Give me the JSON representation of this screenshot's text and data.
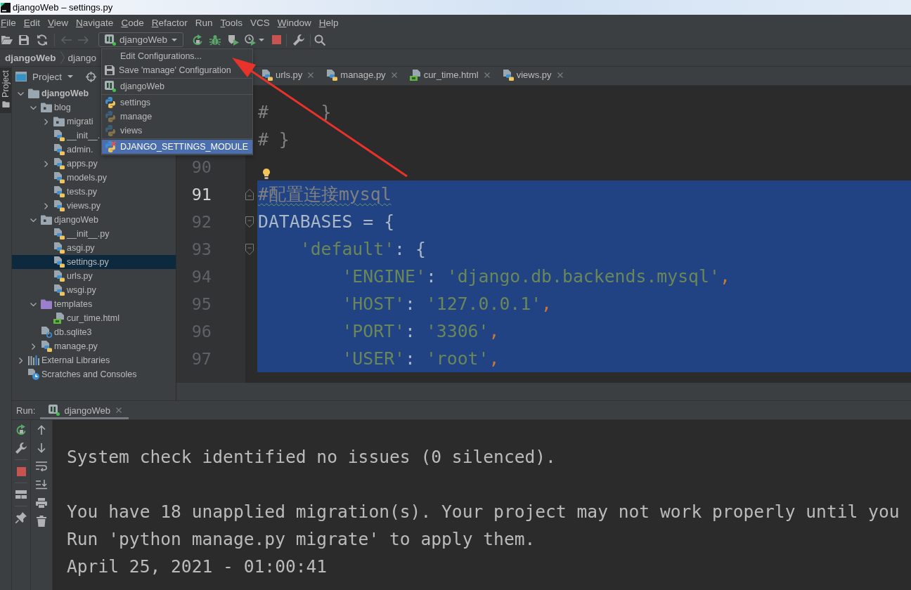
{
  "window": {
    "title": "djangoWeb – settings.py"
  },
  "menu": [
    {
      "label": "File",
      "mnemonic": true
    },
    {
      "label": "Edit",
      "mnemonic": true
    },
    {
      "label": "View",
      "mnemonic": true
    },
    {
      "label": "Navigate",
      "mnemonic": true
    },
    {
      "label": "Code",
      "mnemonic": true
    },
    {
      "label": "Refactor",
      "mnemonic": true
    },
    {
      "label": "Run",
      "mnemonic": false
    },
    {
      "label": "Tools",
      "mnemonic": true
    },
    {
      "label": "VCS",
      "mnemonic": false
    },
    {
      "label": "Window",
      "mnemonic": true
    },
    {
      "label": "Help",
      "mnemonic": true
    }
  ],
  "toolbar": {
    "back": {
      "disabled": true
    },
    "forward": {
      "disabled": true
    },
    "run_config": {
      "label": "djangoWeb",
      "open": true,
      "menu": [
        [
          {
            "label": "Edit Configurations...",
            "kind": "action",
            "selected": false
          },
          {
            "label": "Save 'manage' Configuration",
            "kind": "save",
            "selected": false
          }
        ],
        [
          {
            "label": "djangoWeb",
            "kind": "django",
            "selected": false
          }
        ],
        [
          {
            "label": "settings",
            "kind": "python",
            "selected": false
          },
          {
            "label": "manage",
            "kind": "python-temporary",
            "selected": false
          },
          {
            "label": "views",
            "kind": "python-temporary",
            "selected": false
          }
        ],
        [
          {
            "label": "DJANGO_SETTINGS_MODULE",
            "kind": "python-error",
            "selected": true
          }
        ]
      ]
    },
    "stop": {
      "disabled": false
    }
  },
  "breadcrumbs": [
    {
      "label": "djangoWeb"
    },
    {
      "label": "django"
    }
  ],
  "tool_strip": [
    {
      "label": "Project",
      "selected": true
    }
  ],
  "project": {
    "title": "Project",
    "tree": [
      {
        "label": "djangoWeb",
        "kind": "root",
        "expanded": true,
        "selected": false,
        "children": [
          {
            "label": "blog",
            "kind": "package",
            "expanded": true,
            "selected": false,
            "children": [
              {
                "label": "migrati",
                "kind": "package",
                "expanded": false,
                "selected": false
              },
              {
                "label": "__init__.",
                "kind": "python",
                "selected": false
              },
              {
                "label": "admin.",
                "kind": "python",
                "selected": false
              },
              {
                "label": "apps.py",
                "kind": "python",
                "expanded": false,
                "selected": false
              },
              {
                "label": "models.py",
                "kind": "python",
                "selected": false
              },
              {
                "label": "tests.py",
                "kind": "python",
                "selected": false
              },
              {
                "label": "views.py",
                "kind": "python",
                "expanded": false,
                "selected": false
              }
            ]
          },
          {
            "label": "djangoWeb",
            "kind": "package",
            "expanded": true,
            "selected": false,
            "children": [
              {
                "label": "__init__.py",
                "kind": "python",
                "selected": false
              },
              {
                "label": "asgi.py",
                "kind": "python",
                "selected": false
              },
              {
                "label": "settings.py",
                "kind": "python",
                "selected": true
              },
              {
                "label": "urls.py",
                "kind": "python",
                "selected": false
              },
              {
                "label": "wsgi.py",
                "kind": "python",
                "selected": false
              }
            ]
          },
          {
            "label": "templates",
            "kind": "templates",
            "expanded": true,
            "selected": false,
            "children": [
              {
                "label": "cur_time.html",
                "kind": "html",
                "selected": false
              }
            ]
          },
          {
            "label": "db.sqlite3",
            "kind": "unknown",
            "selected": false
          },
          {
            "label": "manage.py",
            "kind": "python",
            "expanded": false,
            "selected": false
          }
        ]
      },
      {
        "label": "External Libraries",
        "kind": "libraries",
        "expanded": false,
        "selected": false
      },
      {
        "label": "Scratches and Consoles",
        "kind": "scratches",
        "selected": false
      }
    ]
  },
  "editor": {
    "tabs": [
      {
        "label": "urls.py",
        "kind": "python",
        "selected": false
      },
      {
        "label": "manage.py",
        "kind": "python",
        "selected": false
      },
      {
        "label": "cur_time.html",
        "kind": "html",
        "selected": false
      },
      {
        "label": "views.py",
        "kind": "python",
        "selected": false
      }
    ],
    "lines": [
      {
        "tokens": [
          {
            "kind": "comment",
            "text": "#     }"
          }
        ],
        "selected": false
      },
      {
        "tokens": [
          {
            "kind": "comment",
            "text": "# }"
          }
        ],
        "selected": false
      },
      {
        "number": "90",
        "selected": false,
        "current": false,
        "bulb": true
      },
      {
        "number": "91",
        "tokens": [
          {
            "kind": "comment",
            "text": "#配置连接mysql",
            "misspelled": true
          }
        ],
        "selected": true,
        "current": true,
        "fold": {
          "kind": "end"
        }
      },
      {
        "number": "92",
        "tokens": [
          {
            "kind": "plain",
            "text": "DATABASES = {"
          }
        ],
        "selected": true,
        "current": false,
        "fold": {
          "kind": "start"
        }
      },
      {
        "number": "93",
        "tokens": [
          {
            "kind": "string",
            "text": "    'default'"
          },
          {
            "kind": "plain",
            "text": ": {"
          }
        ],
        "selected": true,
        "current": false,
        "fold": {
          "kind": "start"
        }
      },
      {
        "number": "94",
        "tokens": [
          {
            "kind": "string",
            "text": "        'ENGINE'"
          },
          {
            "kind": "plain",
            "text": ": "
          },
          {
            "kind": "string",
            "text": "'django.db.backends.mysql'"
          },
          {
            "kind": "punct",
            "text": ","
          }
        ],
        "selected": true,
        "current": false
      },
      {
        "number": "95",
        "tokens": [
          {
            "kind": "string",
            "text": "        'HOST'"
          },
          {
            "kind": "plain",
            "text": ": "
          },
          {
            "kind": "string",
            "text": "'127.0.0.1'"
          },
          {
            "kind": "punct",
            "text": ","
          }
        ],
        "selected": true,
        "current": false
      },
      {
        "number": "96",
        "tokens": [
          {
            "kind": "string",
            "text": "        'PORT'"
          },
          {
            "kind": "plain",
            "text": ": "
          },
          {
            "kind": "string",
            "text": "'3306'"
          },
          {
            "kind": "punct",
            "text": ","
          }
        ],
        "selected": true,
        "current": false
      },
      {
        "number": "97",
        "tokens": [
          {
            "kind": "string",
            "text": "        'USER'"
          },
          {
            "kind": "plain",
            "text": ": "
          },
          {
            "kind": "string",
            "text": "'root'"
          },
          {
            "kind": "punct",
            "text": ","
          }
        ],
        "selected": true,
        "current": false
      }
    ]
  },
  "run": {
    "label": "Run:",
    "tabs": [
      {
        "label": "djangoWeb",
        "selected": true
      }
    ],
    "stop": {
      "disabled": false
    },
    "console": [
      [
        "System check identified no issues (0 silenced)."
      ],
      [
        "You have 18 unapplied migration(s). Your project may not work properly until you",
        "Run 'python manage.py migrate' to apply them.",
        "April 25, 2021 - 01:00:41"
      ]
    ]
  }
}
